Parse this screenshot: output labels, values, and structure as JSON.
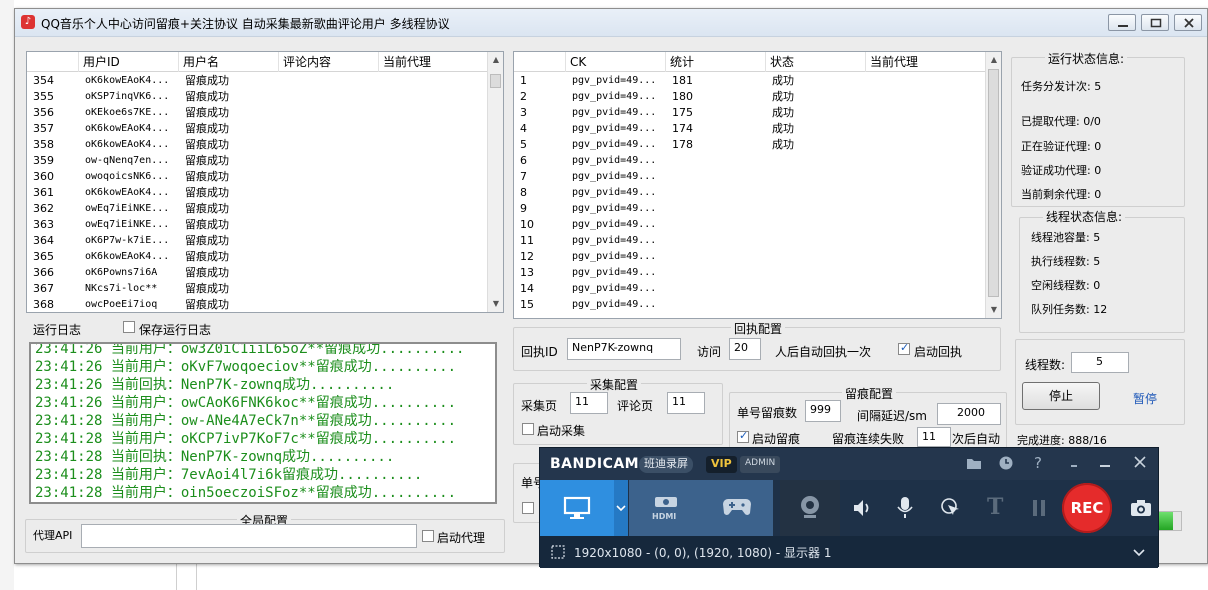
{
  "window": {
    "title": "QQ音乐个人中心访问留痕+关注协议 自动采集最新歌曲评论用户 多线程协议"
  },
  "user_table": {
    "headers": [
      "",
      "用户ID",
      "用户名",
      "评论内容",
      "当前代理"
    ],
    "rows": [
      [
        "354",
        "oK6kowEAoK4...",
        "留痕成功"
      ],
      [
        "355",
        "oKSP7inqVK6...",
        "留痕成功"
      ],
      [
        "356",
        "oKEkoe6s7KE...",
        "留痕成功"
      ],
      [
        "357",
        "oK6kowEAoK4...",
        "留痕成功"
      ],
      [
        "358",
        "oK6kowEAoK4...",
        "留痕成功"
      ],
      [
        "359",
        "ow-qNenq7en...",
        "留痕成功"
      ],
      [
        "360",
        "owoqoicsNK6...",
        "留痕成功"
      ],
      [
        "361",
        "oK6kowEAoK4...",
        "留痕成功"
      ],
      [
        "362",
        "owEq7iEiNKE...",
        "留痕成功"
      ],
      [
        "363",
        "owEq7iEiNKE...",
        "留痕成功"
      ],
      [
        "364",
        "oK6P7w-k7iE...",
        "留痕成功"
      ],
      [
        "365",
        "oK6kowEAoK4...",
        "留痕成功"
      ],
      [
        "366",
        "oK6Powns7i6A",
        "留痕成功"
      ],
      [
        "367",
        "NKcs7i-loc**",
        "留痕成功"
      ],
      [
        "368",
        "owcPoeEi7ioq",
        "留痕成功"
      ]
    ]
  },
  "ck_table": {
    "headers": [
      "",
      "CK",
      "统计",
      "状态",
      "当前代理"
    ],
    "rows": [
      [
        "1",
        "pgv_pvid=49...",
        "181",
        "成功"
      ],
      [
        "2",
        "pgv_pvid=49...",
        "180",
        "成功"
      ],
      [
        "3",
        "pgv_pvid=49...",
        "175",
        "成功"
      ],
      [
        "4",
        "pgv_pvid=49...",
        "174",
        "成功"
      ],
      [
        "5",
        "pgv_pvid=49...",
        "178",
        "成功"
      ],
      [
        "6",
        "pgv_pvid=49...",
        "",
        ""
      ],
      [
        "7",
        "pgv_pvid=49...",
        "",
        ""
      ],
      [
        "8",
        "pgv_pvid=49...",
        "",
        ""
      ],
      [
        "9",
        "pgv_pvid=49...",
        "",
        ""
      ],
      [
        "10",
        "pgv_pvid=49...",
        "",
        ""
      ],
      [
        "11",
        "pgv_pvid=49...",
        "",
        ""
      ],
      [
        "12",
        "pgv_pvid=49...",
        "",
        ""
      ],
      [
        "13",
        "pgv_pvid=49...",
        "",
        ""
      ],
      [
        "14",
        "pgv_pvid=49...",
        "",
        ""
      ],
      [
        "15",
        "pgv_pvid=49...",
        "",
        ""
      ]
    ]
  },
  "log": {
    "label": "运行日志",
    "save_label": "保存运行日志",
    "lines": [
      "23:41:26 当前用户：ow3Z0iC1iiL65oZ**留痕成功..........",
      "23:41:26 当前用户：oKvF7woqoeciov**留痕成功..........",
      "23:41:26 当前回执：NenP7K-zownq成功..........",
      "23:41:26 当前用户：owCAoK6FNK6koc**留痕成功..........",
      "23:41:28 当前用户：ow-ANe4A7eCk7n**留痕成功..........",
      "23:41:28 当前用户：oKCP7ivP7KoF7c**留痕成功..........",
      "23:41:28 当前回执：NenP7K-zownq成功..........",
      "23:41:28 当前用户：7evAoi4l7i6k留痕成功..........",
      "23:41:28 当前用户：oin5oeczoiSFoz**留痕成功.........."
    ]
  },
  "global_config": {
    "title": "全局配置",
    "proxy_api_label": "代理API",
    "proxy_api_value": "",
    "enable_proxy_label": "启动代理"
  },
  "receipt_config": {
    "title": "回执配置",
    "id_label": "回执ID",
    "id_value": "NenP7K-zownq",
    "visit_label": "访问",
    "visit_value": "20",
    "after_label": "人后自动回执一次",
    "enable_label": "启动回执"
  },
  "collect_config": {
    "title": "采集配置",
    "collect_page_label": "采集页",
    "collect_page_value": "11",
    "comment_page_label": "评论页",
    "comment_page_value": "11",
    "enable_label": "启动采集"
  },
  "trace_config": {
    "title": "留痕配置",
    "single_count_label": "单号留痕数",
    "single_count_value": "999",
    "delay_label": "间隔延迟/sm",
    "delay_value": "2000",
    "enable_label": "启动留痕",
    "fail_label": "留痕连续失败",
    "fail_value": "11",
    "fail_suffix": "次后自动",
    "hidden_label": "单号"
  },
  "run_status": {
    "title": "运行状态信息:",
    "items": [
      "任务分发计次: 5",
      "已提取代理: 0/0",
      "正在验证代理: 0",
      "验证成功代理: 0",
      "当前剩余代理: 0"
    ]
  },
  "thread_status": {
    "title": "线程状态信息:",
    "items": [
      "线程池容量: 5",
      "执行线程数: 5",
      "空闲线程数: 0",
      "队列任务数: 12"
    ]
  },
  "controls": {
    "thread_label": "线程数:",
    "thread_value": "5",
    "stop_label": "停止",
    "pause_label": "暂停",
    "progress_label": "完成进度: 888/16",
    "progress_fraction": 0.95
  },
  "bandicam": {
    "logo_a": "BANDI",
    "logo_b": "CAM",
    "tag": "班迪录屏",
    "vip": "VIP",
    "admin": "ADMIN",
    "hdmi_label": "HDMI",
    "rec_label": "REC",
    "text_tool_label": "T",
    "status": "1920x1080 - (0, 0), (1920, 1080) - 显示器 1"
  },
  "colors": {
    "log_text": "#1c8e1c",
    "pause_link": "#1d57b8",
    "rec": "#e52b2b",
    "bandicam_bg": "#1e3148"
  }
}
